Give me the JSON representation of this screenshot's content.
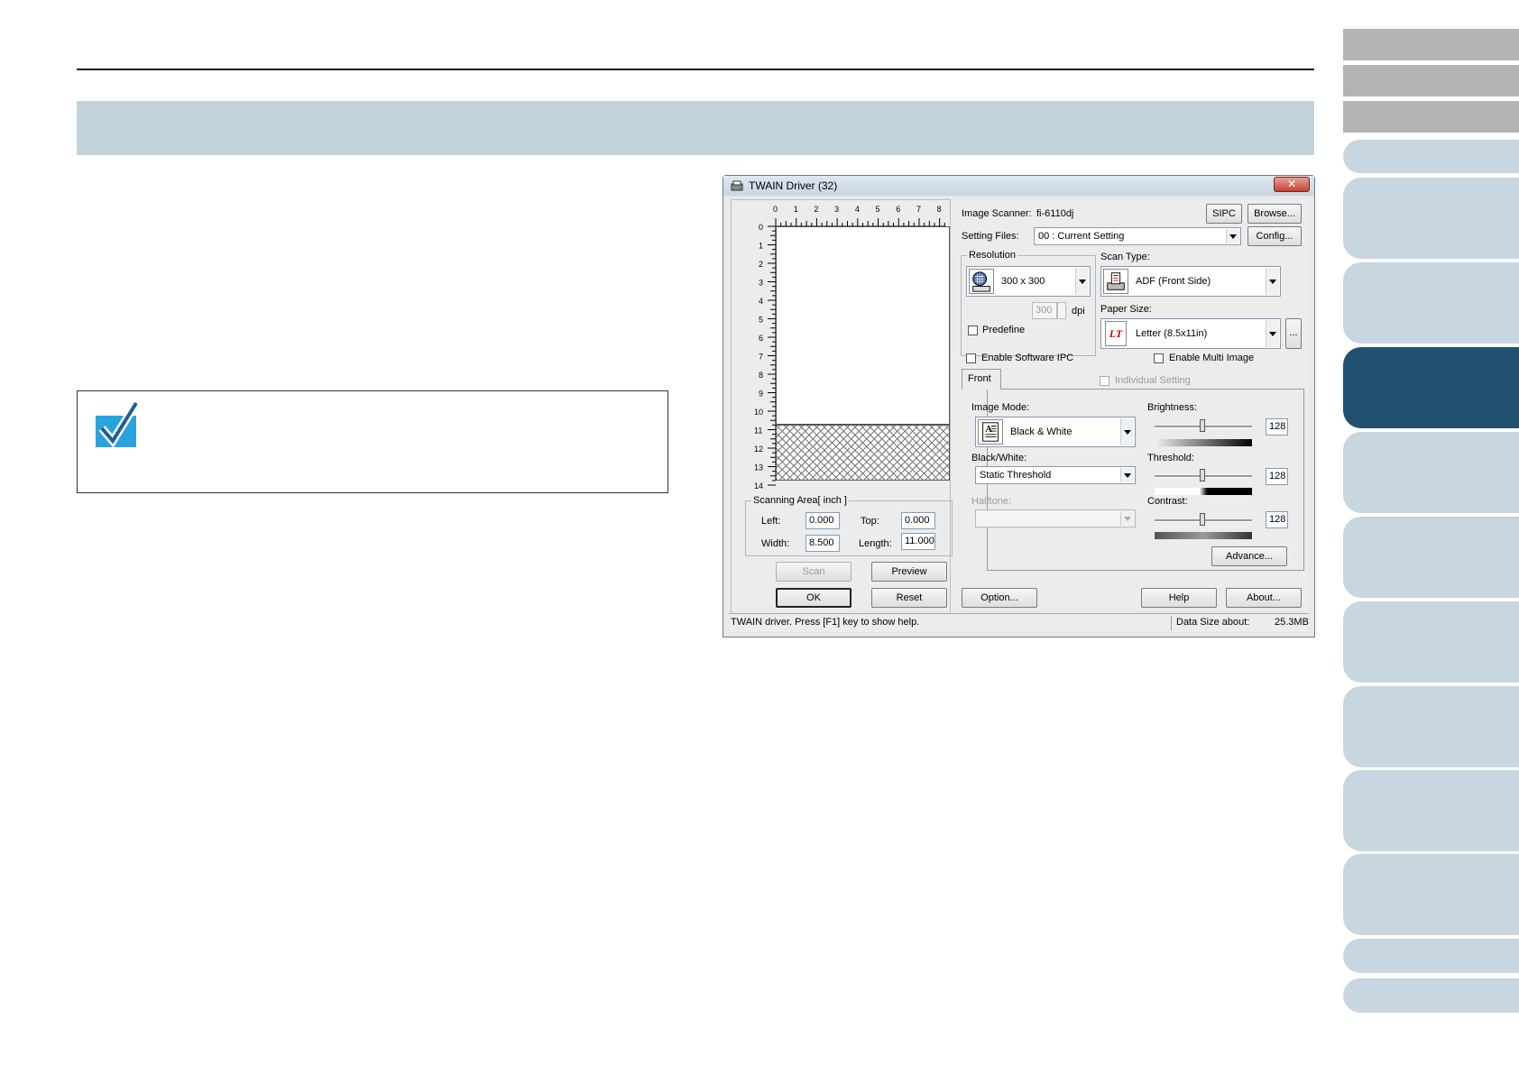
{
  "dialog": {
    "title": "TWAIN Driver (32)",
    "close_glyph": "✕",
    "image_scanner_label": "Image Scanner:",
    "image_scanner_value": "fi-6110dj",
    "sipc_label": "SIPC",
    "browse_label": "Browse...",
    "setting_files_label": "Setting Files:",
    "setting_files_value": "00 : Current Setting",
    "config_label": "Config...",
    "resolution_group": "Resolution",
    "resolution_value": "300 x 300",
    "dpi_value": "300",
    "dpi_label": "dpi",
    "predefine_label": "Predefine",
    "scan_type_label": "Scan Type:",
    "scan_type_value": "ADF (Front Side)",
    "paper_size_label": "Paper Size:",
    "paper_size_value": "Letter (8.5x11in)",
    "paper_size_icon_text": "LT",
    "paper_more_label": "...",
    "enable_software_ipc": "Enable Software IPC",
    "enable_multi_image": "Enable Multi Image",
    "front_tab": "Front",
    "individual_setting": "Individual Setting",
    "image_mode_label": "Image Mode:",
    "image_mode_value": "Black & White",
    "black_white_label": "Black/White:",
    "black_white_value": "Static Threshold",
    "halftone_label": "Halftone:",
    "brightness_label": "Brightness:",
    "brightness_value": "128",
    "threshold_label": "Threshold:",
    "threshold_value": "128",
    "contrast_label": "Contrast:",
    "contrast_value": "128",
    "advance_label": "Advance...",
    "scanning_area_label": "Scanning Area[ inch ]",
    "left_label": "Left:",
    "left_value": "0.000",
    "top_label": "Top:",
    "top_value": "0.000",
    "width_label": "Width:",
    "width_value": "8.500",
    "length_label": "Length:",
    "length_value": "11.000",
    "scan_label": "Scan",
    "preview_label": "Preview",
    "ok_label": "OK",
    "reset_label": "Reset",
    "option_label": "Option...",
    "help_label": "Help",
    "about_label": "About...",
    "status_text": "TWAIN driver. Press [F1] key to show help.",
    "data_size_label": "Data Size about:",
    "data_size_value": "25.3MB",
    "ruler_h": [
      "0",
      "1",
      "2",
      "3",
      "4",
      "5",
      "6",
      "7",
      "8"
    ],
    "ruler_v": [
      "0",
      "1",
      "2",
      "3",
      "4",
      "5",
      "6",
      "7",
      "8",
      "9",
      "10",
      "11",
      "12",
      "13",
      "14"
    ]
  },
  "icons": {
    "note": "checkmark-icon",
    "scanner": "scanner-icon",
    "resolution": "resolution-icon",
    "image_mode": "document-icon"
  },
  "colors": {
    "banner": "#c3d3dc",
    "tab_active": "#21516f",
    "tab_light": "#c7d6df",
    "tab_grey": "#b3b3b3",
    "check_blue": "#29a3e0"
  }
}
